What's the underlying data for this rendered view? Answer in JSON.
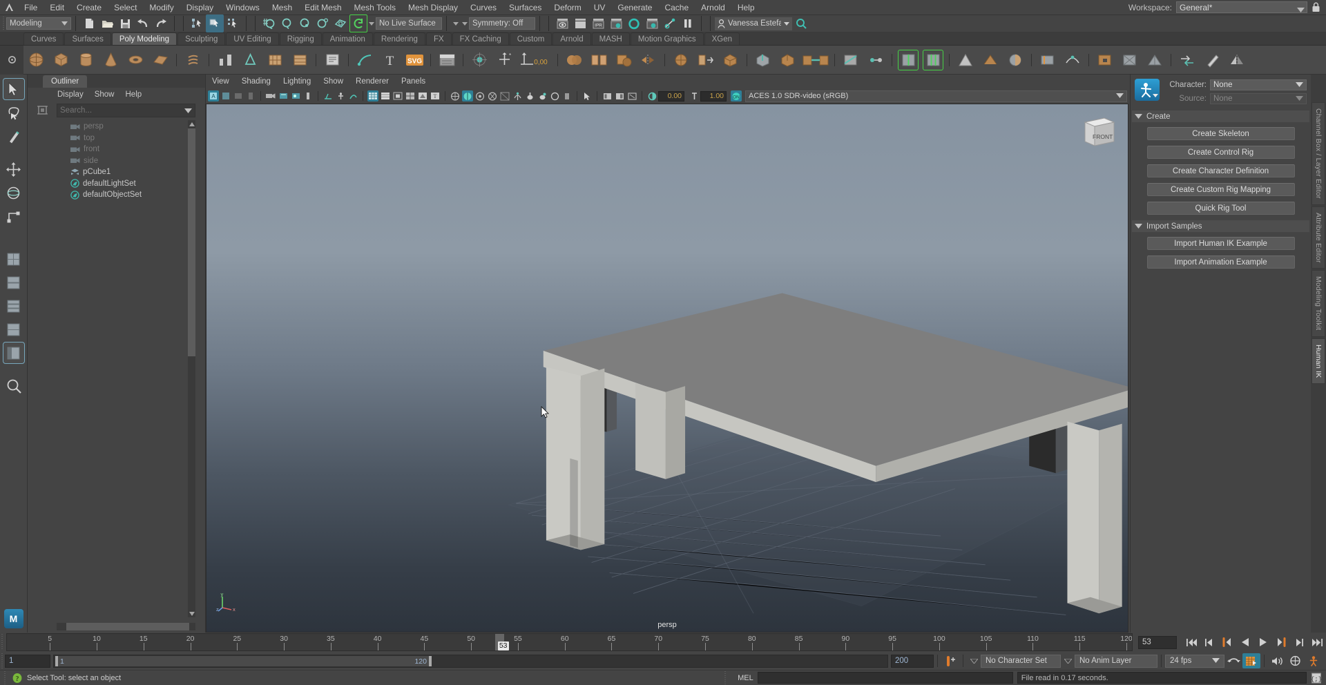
{
  "app": {
    "title": "Autodesk Maya",
    "home_icon": "maya-home-icon"
  },
  "menubar": {
    "items": [
      "File",
      "Edit",
      "Create",
      "Select",
      "Modify",
      "Display",
      "Windows",
      "Mesh",
      "Edit Mesh",
      "Mesh Tools",
      "Mesh Display",
      "Curves",
      "Surfaces",
      "Deform",
      "UV",
      "Generate",
      "Cache",
      "Arnold",
      "Help"
    ],
    "workspace_label": "Workspace:",
    "workspace_value": "General*",
    "lock_icon": "lock-icon"
  },
  "statusline": {
    "menuset": "Modeling",
    "file_icons": [
      "new-scene-icon",
      "open-scene-icon",
      "save-scene-icon",
      "undo-icon",
      "redo-icon"
    ],
    "select_mode_icons": [
      "select-by-hierarchy-icon",
      "select-by-object-icon",
      "select-by-component-icon"
    ],
    "snap_icons": [
      "snap-to-grid-icon",
      "snap-to-curve-icon",
      "snap-to-point-icon",
      "snap-to-projected-center-icon",
      "snap-to-view-plane-icon",
      "make-live-icon"
    ],
    "live_surface": "No Live Surface",
    "symmetry": "Symmetry: Off",
    "render_icons": [
      "render-current-frame-icon",
      "render-sequence-icon",
      "ipr-render-icon",
      "render-settings-icon",
      "hypershade-icon",
      "render-view-icon",
      "light-linking-icon",
      "pause-icon"
    ],
    "user": "Vanessa Estefanía G..",
    "search_icon": "search-icon"
  },
  "shelf": {
    "tabs": [
      "Curves",
      "Surfaces",
      "Poly Modeling",
      "Sculpting",
      "UV Editing",
      "Rigging",
      "Animation",
      "Rendering",
      "FX",
      "FX Caching",
      "Custom",
      "Arnold",
      "MASH",
      "Motion Graphics",
      "XGen"
    ],
    "active_tab": "Poly Modeling",
    "buttons": [
      "poly-sphere-icon",
      "poly-cube-icon",
      "poly-cylinder-icon",
      "poly-cone-icon",
      "poly-torus-icon",
      "poly-plane-icon",
      "poly-helix-icon",
      "poly-pipe-icon",
      "poly-prism-icon",
      "poly-pyramid-icon",
      "poly-platonic-icon",
      "svg-curve-icon",
      "text-icon",
      "svg-icon",
      "type-icon",
      "sculpt-mesh-icon",
      "soft-select-icon",
      "move-tool-value-icon",
      "combine-icon",
      "separate-icon",
      "booleans-icon",
      "mirror-icon",
      "smooth-icon",
      "reduce-icon",
      "extract-icon",
      "extrude-icon",
      "bevel-icon",
      "bridge-icon",
      "append-polygon-icon",
      "multi-cut-icon",
      "target-weld-icon",
      "insert-edge-loop-icon",
      "offset-edge-loop-icon",
      "quad-draw-icon",
      "crease-tool-icon",
      "paint-reduce-icon",
      "slide-edge-icon",
      "sew-icon",
      "chamfer-vertex-icon",
      "poke-icon",
      "wedge-icon",
      "duplicate-face-icon",
      "connect-icon",
      "detach-icon",
      "merge-icon",
      "spin-edge-icon"
    ]
  },
  "toolbox": {
    "tools": [
      "select-tool-icon",
      "lasso-select-tool-icon",
      "paint-select-tool-icon",
      "move-tool-icon",
      "rotate-tool-icon",
      "scale-tool-icon"
    ],
    "layout_tools": [
      "single-pane-layout-icon",
      "two-pane-split-layout-icon",
      "three-pane-layout-icon",
      "four-pane-layout-icon",
      "persp-outliner-layout-icon",
      "magnify-layout-icon"
    ],
    "logo": "maya-logo-icon"
  },
  "outliner": {
    "tab": "Outliner",
    "menus": [
      "Display",
      "Show",
      "Help"
    ],
    "search_placeholder": "Search...",
    "filter_icon": "outliner-filter-icon",
    "dropdown_icon": "chevron-down-icon",
    "items": [
      {
        "label": "persp",
        "icon": "camera-icon",
        "dim": true
      },
      {
        "label": "top",
        "icon": "camera-icon",
        "dim": true
      },
      {
        "label": "front",
        "icon": "camera-icon",
        "dim": true
      },
      {
        "label": "side",
        "icon": "camera-icon",
        "dim": true
      },
      {
        "label": "pCube1",
        "icon": "mesh-icon",
        "dim": false
      },
      {
        "label": "defaultLightSet",
        "icon": "set-icon",
        "dim": false
      },
      {
        "label": "defaultObjectSet",
        "icon": "set-icon",
        "dim": false
      }
    ]
  },
  "viewport": {
    "menus": [
      "View",
      "Shading",
      "Lighting",
      "Show",
      "Renderer",
      "Panels"
    ],
    "exposure_value": "0.00",
    "gamma_value": "1.00",
    "color_space": "ACES 1.0 SDR-video (sRGB)",
    "camera_label": "persp",
    "view_cube_label": "FRONT",
    "axis_x": "x",
    "axis_y": "y",
    "axis_z": "z",
    "toolbar_icons": [
      "select-camera-icon",
      "lock-camera-icon",
      "camera-attributes-icon",
      "bookmark-icon",
      "grid-icon",
      "film-gate-icon",
      "resolution-gate-icon",
      "gate-mask-icon",
      "exposure-icon",
      "two-sided-lighting-icon",
      "shadows-icon",
      "image-plane-icon",
      "wireframe-icon",
      "smooth-shade-icon",
      "flat-shade-icon",
      "wireframe-on-shaded-icon",
      "texture-icon",
      "xray-icon",
      "use-default-light-icon",
      "use-all-lights-icon",
      "shadow-icon",
      "ao-icon",
      "motion-blur-icon",
      "aa-icon",
      "multisample-icon",
      "dof-icon",
      "isolate-select-icon",
      "grid-toggle-icon",
      "film-gate-toggle-icon",
      "gate-mask-toggle-icon",
      "exposure-gain-icon",
      "gamma-icon",
      "color-management-icon"
    ]
  },
  "humanik": {
    "logo": "humanik-logo-icon",
    "character_label": "Character:",
    "character_value": "None",
    "source_label": "Source:",
    "source_value": "None",
    "sections": [
      {
        "title": "Create",
        "buttons": [
          "Create Skeleton",
          "Create Control Rig",
          "Create Character Definition",
          "Create Custom Rig Mapping",
          "Quick Rig Tool"
        ]
      },
      {
        "title": "Import Samples",
        "buttons": [
          "Import Human IK Example",
          "Import Animation Example"
        ]
      }
    ]
  },
  "right_tabs": {
    "items": [
      "Channel Box / Layer Editor",
      "Attribute Editor",
      "Modeling Toolkit",
      "Human IK"
    ],
    "active": "Human IK"
  },
  "timeslider": {
    "ticks": [
      5,
      10,
      15,
      20,
      25,
      30,
      35,
      40,
      45,
      50,
      55,
      60,
      65,
      70,
      75,
      80,
      85,
      90,
      95,
      100,
      105,
      110,
      115,
      120
    ],
    "range_start": 1,
    "range_end": 120,
    "current_frame": "53",
    "current_frame_field": "53",
    "playback_icons": [
      "go-to-start-icon",
      "step-back-frame-icon",
      "step-back-key-icon",
      "play-backwards-icon",
      "play-forwards-icon",
      "step-forward-key-icon",
      "step-forward-frame-icon",
      "go-to-end-icon"
    ]
  },
  "rangeslider": {
    "anim_start": "1",
    "range_start": "1",
    "range_end": "120",
    "anim_end": "200",
    "auto_key_icon": "auto-keyframe-icon",
    "character_set": "No Character Set",
    "anim_layer": "No Anim Layer",
    "fps": "24 fps",
    "loop_icon": "playback-loop-icon",
    "prefs_icon": "animation-preferences-icon",
    "audio_icon": "audio-icon",
    "sync_icon": "sync-icon",
    "hik_icon": "character-icon"
  },
  "helpline": {
    "status_icon": "help-icon",
    "text": "Select Tool: select an object",
    "mel_label": "MEL",
    "command_input_value": "",
    "output": "File read in  0.17 seconds.",
    "script_editor_icon": "script-editor-icon"
  },
  "colors": {
    "accent_teal": "#2e7f97",
    "bg": "#444444",
    "panel": "#3a3a3a",
    "green_outline": "#46d246",
    "orange": "#e07b2c"
  }
}
